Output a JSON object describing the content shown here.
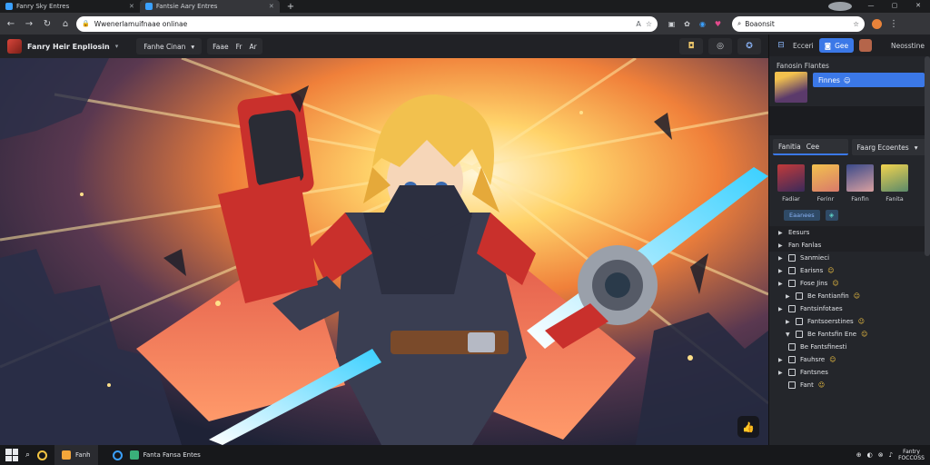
{
  "browser": {
    "tabs": [
      {
        "label": "Fanry Sky Entres",
        "active": false
      },
      {
        "label": "Fantsie Aary Entres",
        "active": true
      }
    ],
    "new_tab_glyph": "+",
    "window_controls": [
      "—",
      "▢",
      "✕"
    ],
    "nav": {
      "back": "←",
      "forward": "→",
      "reload": "↻",
      "home": "⌂"
    },
    "url": "Wwenerlamuifnaae onlinae",
    "omnibox_icons": [
      "A",
      "☆"
    ],
    "extensions": [
      "▣",
      "✿",
      "◉",
      "♥"
    ],
    "search": {
      "value": "Boaonsit",
      "star": "☆"
    },
    "menu": "⋮"
  },
  "app": {
    "title": "Fanry Heir Enpliosin",
    "caret": "▾",
    "dropdown": {
      "label": "Fanhe Cinan",
      "caret": "▾"
    },
    "chip": {
      "a": "Faae",
      "b": "Fr",
      "c": "Ar"
    },
    "right_buttons": [
      "◘",
      "◎",
      "✪"
    ]
  },
  "sidebar": {
    "top": {
      "icon": "⊟",
      "tab1": "Ecceri",
      "tab_active": "Gee",
      "more": "Neosstine"
    },
    "section_title": "Fanosin Flantes",
    "current_selection": {
      "label": "Finnes",
      "emoji": "☺"
    },
    "tabs2": [
      {
        "label": "Fanitia",
        "extra": "Cee",
        "active": true
      },
      {
        "label": "Faarg Ecoentes",
        "extra": "▾",
        "active": false
      }
    ],
    "gallery": [
      {
        "caption": "Fadiar",
        "color": "linear-gradient(160deg,#c23a3a,#3b2a5a)"
      },
      {
        "caption": "Ferinr",
        "color": "linear-gradient(160deg,#f2c14e,#d97a6a)"
      },
      {
        "caption": "Fanfin",
        "color": "linear-gradient(160deg,#3a4a8a,#d9a0a0)"
      },
      {
        "caption": "Fanita",
        "color": "linear-gradient(160deg,#f2d34e,#5b8a6a)"
      }
    ],
    "pill": "Eaanees",
    "pill_icon": "◈",
    "tree": [
      {
        "kind": "head",
        "label": "Eesurs",
        "arrow": "▶"
      },
      {
        "kind": "head",
        "label": "Fan Fanlas",
        "arrow": "▶"
      },
      {
        "kind": "item",
        "label": "Sanmieci",
        "arrow": "▶",
        "emoji": ""
      },
      {
        "kind": "item",
        "label": "Earisns",
        "arrow": "▶",
        "emoji": "☺"
      },
      {
        "kind": "item",
        "label": "Fose Jins",
        "arrow": "▶",
        "emoji": "☺"
      },
      {
        "kind": "sub",
        "label": "Be Fantianfin",
        "arrow": "▶",
        "emoji": "☺"
      },
      {
        "kind": "item",
        "label": "Fantsinfotaes",
        "arrow": "▶",
        "emoji": ""
      },
      {
        "kind": "sub",
        "label": "Fantsoerstines",
        "arrow": "▶",
        "emoji": "☺"
      },
      {
        "kind": "sub",
        "label": "Be Fantsfin Ene",
        "arrow": "▼",
        "emoji": "☺"
      },
      {
        "kind": "item",
        "label": "Be Fantsfinesti",
        "arrow": "",
        "emoji": ""
      },
      {
        "kind": "item",
        "label": "Fauhsre",
        "arrow": "▶",
        "emoji": "☺"
      },
      {
        "kind": "item",
        "label": "Fantsnes",
        "arrow": "▶",
        "emoji": ""
      },
      {
        "kind": "item",
        "label": "Fant",
        "arrow": "",
        "emoji": "☺"
      }
    ]
  },
  "artwork": {
    "like_icon": "👍"
  },
  "taskbar": {
    "search_glyph": "⌕",
    "app_label": "Fanh",
    "app2_label": "Fanta Fansa Entes",
    "tray_icons": [
      "⊕",
      "◐",
      "⊗",
      "♪"
    ],
    "clock": {
      "time": "Fantry",
      "date": "FOCCOSS"
    }
  }
}
